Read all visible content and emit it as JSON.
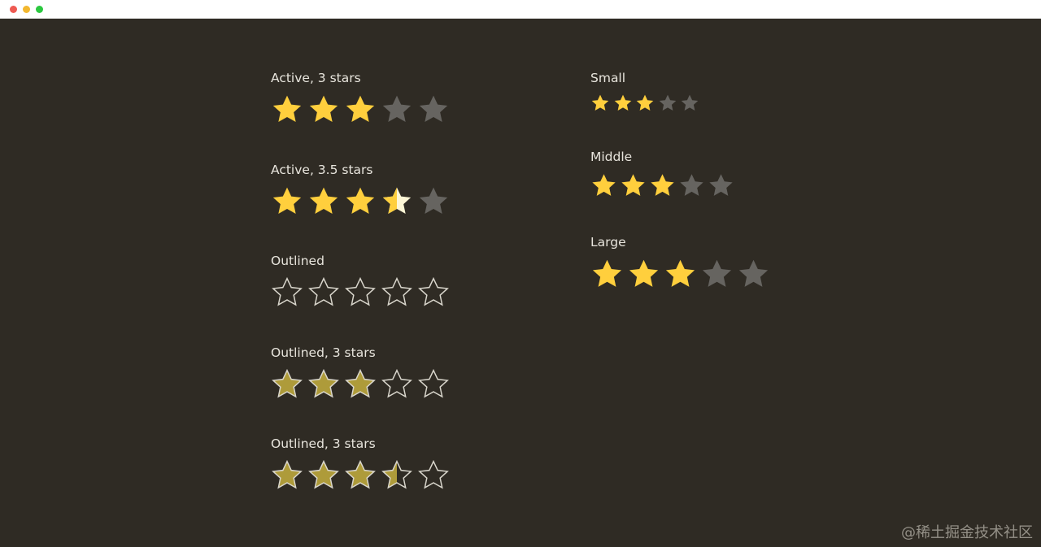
{
  "colors": {
    "background": "#2f2b24",
    "active": "#ffcf3d",
    "inactive": "#666460",
    "half_light": "#fdf6d6",
    "outlined_fill": "#ae9b3a",
    "outline": "#d9d6cc"
  },
  "watermark": "@稀土掘金技术社区",
  "left_column": [
    {
      "label": "Active, 3 stars",
      "variant": "filled",
      "rating": 3,
      "max": 5
    },
    {
      "label": "Active, 3.5 stars",
      "variant": "filled-half",
      "rating": 3.5,
      "max": 5
    },
    {
      "label": "Outlined",
      "variant": "outlined",
      "rating": 0,
      "max": 5
    },
    {
      "label": "Outlined, 3 stars",
      "variant": "outlined",
      "rating": 3,
      "max": 5
    },
    {
      "label": "Outlined, 3 stars",
      "variant": "outlined",
      "rating": 3.5,
      "max": 5
    }
  ],
  "right_column": [
    {
      "label": "Small",
      "variant": "filled",
      "rating": 3,
      "max": 5
    },
    {
      "label": "Middle",
      "variant": "filled",
      "rating": 3,
      "max": 5
    },
    {
      "label": "Large",
      "variant": "filled",
      "rating": 3,
      "max": 5
    }
  ]
}
